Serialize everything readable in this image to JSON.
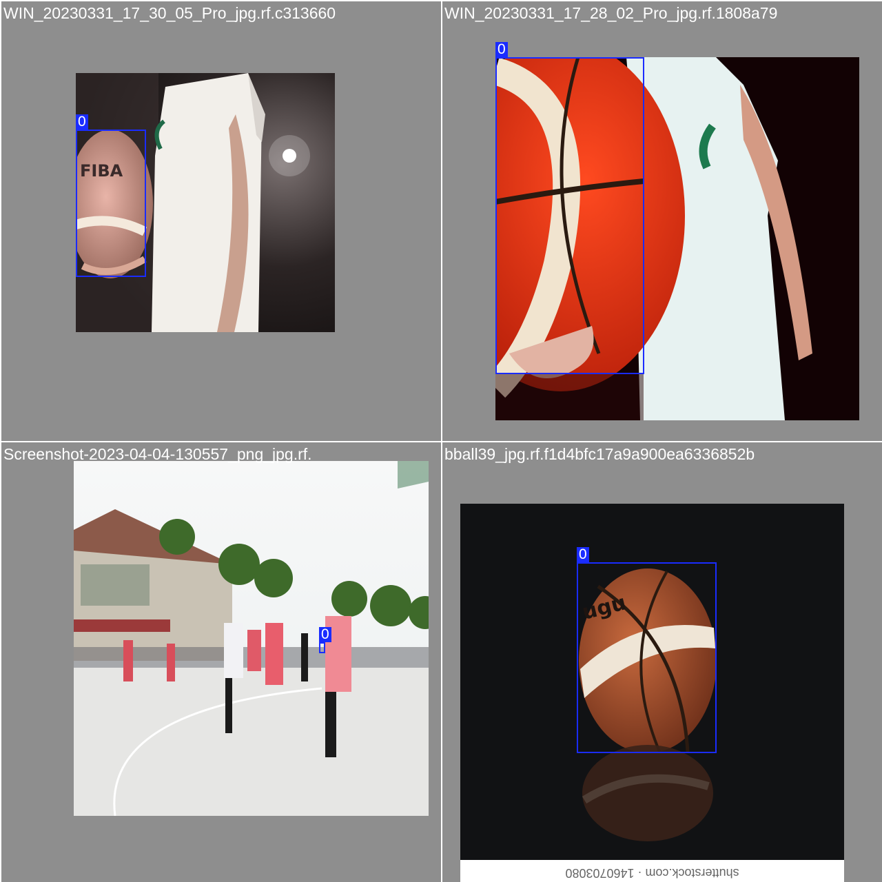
{
  "grid": [
    {
      "caption": "WIN_20230331_17_30_05_Pro_jpg.rf.c313660",
      "detections": [
        {
          "label": "0"
        }
      ]
    },
    {
      "caption": "WIN_20230331_17_28_02_Pro_jpg.rf.1808a79",
      "detections": [
        {
          "label": "0"
        }
      ]
    },
    {
      "caption": "Screenshot-2023-04-04-130557_png_jpg.rf.",
      "detections": [
        {
          "label": "0"
        }
      ]
    },
    {
      "caption": "bball39_jpg.rf.f1d4bfc17a9a900ea6336852b",
      "detections": [
        {
          "label": "0"
        }
      ],
      "watermark": "shutterstock.com · 1460703080"
    }
  ],
  "colors": {
    "tile_background": "#8e8e8e",
    "box": "#1a2cff",
    "caption_text": "#ffffff"
  }
}
